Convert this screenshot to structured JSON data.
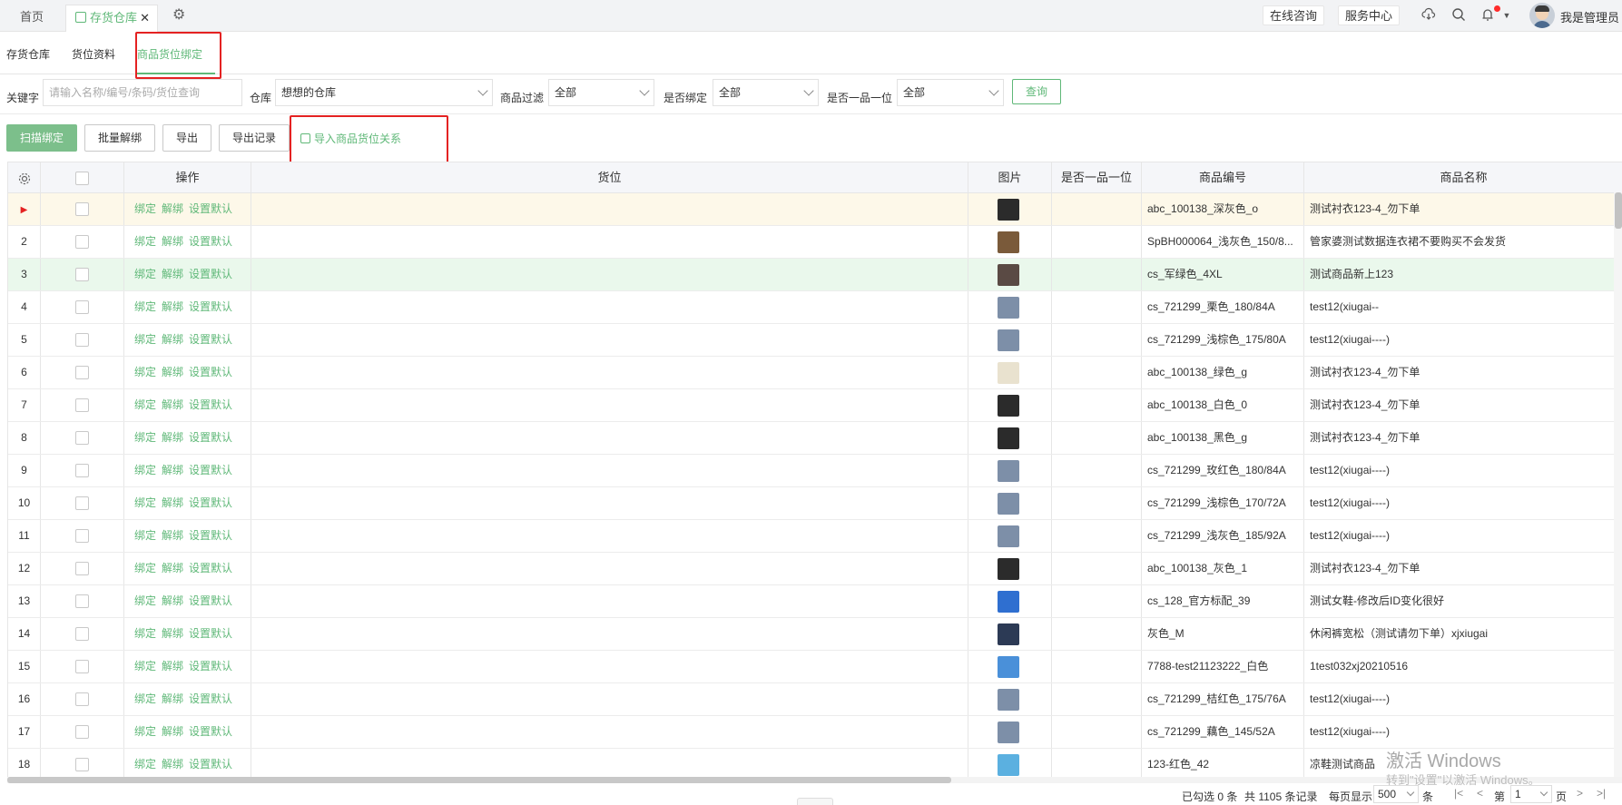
{
  "topbar": {
    "tab_home": "首页",
    "tab_active": "存货仓库",
    "tab_close": "✕",
    "online_consult": "在线咨询",
    "service_center": "服务中心",
    "username": "我是管理员"
  },
  "subtabs": [
    "存货仓库",
    "货位资料",
    "商品货位绑定"
  ],
  "filters": {
    "keyword_label": "关键字",
    "keyword_placeholder": "请输入名称/编号/条码/货位查询",
    "warehouse_label": "仓库",
    "warehouse_value": "想想的仓库",
    "goods_filter_label": "商品过滤",
    "goods_filter_value": "全部",
    "bound_label": "是否绑定",
    "bound_value": "全部",
    "one_item_label": "是否一品一位",
    "one_item_value": "全部",
    "query_label": "查询"
  },
  "toolbar": {
    "scan_bind": "扫描绑定",
    "batch_unbind": "批量解绑",
    "export": "导出",
    "export_log": "导出记录",
    "import_relation": "导入商品货位关系"
  },
  "table": {
    "headers": {
      "ops": "操作",
      "location": "货位",
      "image": "图片",
      "one_item": "是否一品一位",
      "code": "商品编号",
      "name": "商品名称"
    },
    "actions": [
      "绑定",
      "解绑",
      "设置默认"
    ],
    "rows": [
      {
        "no": "",
        "code": "abc_100138_深灰色_o",
        "name": "测试衬衣123-4_勿下单",
        "thumb": "#2b2b2b"
      },
      {
        "no": "2",
        "code": "SpBH000064_浅灰色_150/8...",
        "name": "管家婆测试数据连衣裙不要购买不会发货",
        "thumb": "#7a5a3a"
      },
      {
        "no": "3",
        "code": "cs_军绿色_4XL",
        "name": "测试商品新上123",
        "thumb": "#5a4a44"
      },
      {
        "no": "4",
        "code": "cs_721299_栗色_180/84A",
        "name": "test12(xiugai--",
        "thumb": "#7d8fa8"
      },
      {
        "no": "5",
        "code": "cs_721299_浅棕色_175/80A",
        "name": "test12(xiugai----)",
        "thumb": "#7d8fa8"
      },
      {
        "no": "6",
        "code": "abc_100138_绿色_g",
        "name": "测试衬衣123-4_勿下单",
        "thumb": "#e9e2cf"
      },
      {
        "no": "7",
        "code": "abc_100138_白色_0",
        "name": "测试衬衣123-4_勿下单",
        "thumb": "#2b2b2b"
      },
      {
        "no": "8",
        "code": "abc_100138_黑色_g",
        "name": "测试衬衣123-4_勿下单",
        "thumb": "#2b2b2b"
      },
      {
        "no": "9",
        "code": "cs_721299_玫红色_180/84A",
        "name": "test12(xiugai----)",
        "thumb": "#7d8fa8"
      },
      {
        "no": "10",
        "code": "cs_721299_浅棕色_170/72A",
        "name": "test12(xiugai----)",
        "thumb": "#7d8fa8"
      },
      {
        "no": "11",
        "code": "cs_721299_浅灰色_185/92A",
        "name": "test12(xiugai----)",
        "thumb": "#7d8fa8"
      },
      {
        "no": "12",
        "code": "abc_100138_灰色_1",
        "name": "测试衬衣123-4_勿下单",
        "thumb": "#2b2b2b"
      },
      {
        "no": "13",
        "code": "cs_128_官方标配_39",
        "name": "测试女鞋-修改后ID变化很好",
        "thumb": "#2f6fd0"
      },
      {
        "no": "14",
        "code": "灰色_M",
        "name": "休闲裤宽松（测试请勿下单）xjxiugai",
        "thumb": "#2c3a55"
      },
      {
        "no": "15",
        "code": "7788-test21123222_白色",
        "name": "1test032xj20210516",
        "thumb": "#4a90d9"
      },
      {
        "no": "16",
        "code": "cs_721299_桔红色_175/76A",
        "name": "test12(xiugai----)",
        "thumb": "#7d8fa8"
      },
      {
        "no": "17",
        "code": "cs_721299_藕色_145/52A",
        "name": "test12(xiugai----)",
        "thumb": "#7d8fa8"
      },
      {
        "no": "18",
        "code": "123-红色_42",
        "name": "凉鞋测试商品",
        "thumb": "#5bb0e0"
      }
    ]
  },
  "footer": {
    "selected": "已勾选 0 条",
    "total": "共 1105 条记录",
    "per_page_label": "每页显示",
    "per_page_value": "500",
    "unit": "条",
    "page_label": "第",
    "page_value": "1",
    "page_unit": "页"
  },
  "watermark": {
    "line1": "激活 Windows",
    "line2": "转到\"设置\"以激活 Windows。"
  },
  "colors": {
    "accent": "#5fb878",
    "highlight_box": "#e42222",
    "selected_row": "#fdf8e9",
    "hover_row": "#eaf8ec"
  }
}
